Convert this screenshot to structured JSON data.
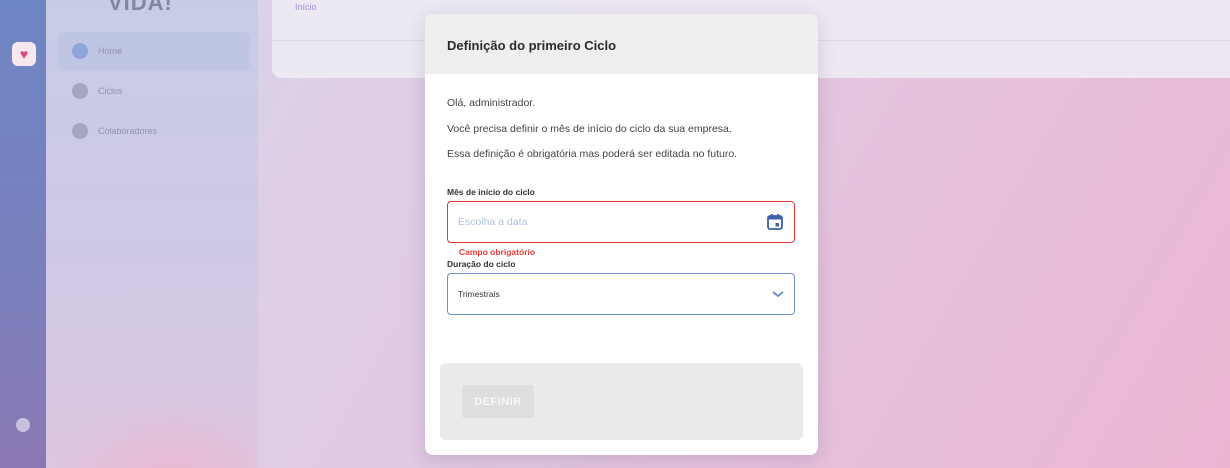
{
  "background": {
    "brand": "VIDA!",
    "top_link": "Início",
    "sidebar_items": [
      {
        "label": "Home"
      },
      {
        "label": "Ciclos"
      },
      {
        "label": "Colaboradores"
      }
    ]
  },
  "modal": {
    "title": "Definição do primeiro Ciclo",
    "paragraphs": [
      "Olá, administrador.",
      "Você precisa definir o mês de início do ciclo da sua empresa.",
      "Essa definição é obrigatória mas poderá ser editada no futuro."
    ],
    "start_month": {
      "label": "Mês de início do ciclo",
      "placeholder": "Escolha a data",
      "icon": "calendar-icon",
      "error": "Campo obrigatório"
    },
    "duration": {
      "label": "Duração do ciclo",
      "selected": "Trimestrais",
      "icon": "chevron-down-icon"
    },
    "button": {
      "label": "DEFINIR",
      "disabled": true
    }
  },
  "colors": {
    "accent": "#6f8fd0",
    "error": "#e53935",
    "calendar": "#3f5fa8"
  }
}
